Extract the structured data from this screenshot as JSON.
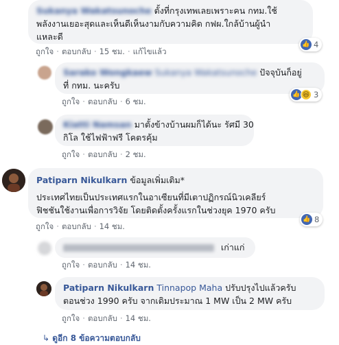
{
  "comments": [
    {
      "author": "Sukanya Wakatsunoche",
      "author_edited_note": "",
      "text": "ตั้งที่กรุงเทพเลยเพราะคน กทม.ใช้พลังงานเยอะสุดและเห็นดีเห็นงามกับความคิด กฟผ.ใกล้บ้านผู้นำแหละดี",
      "text_line1": "ตั้งที่กรุงเทพเลยเพราะคน กทม.ใช้",
      "text_line2": "พลังงานเยอะสุดและเห็นดีเห็นงามกับความคิด กฟผ.ใกล้บ้านผู้นำ",
      "text_line3": "แหละดี",
      "like": "ถูกใจ",
      "reply": "ตอบกลับ",
      "time": "15 ชม.",
      "edited": "แก้ไขแล้ว",
      "reactions": "4"
    },
    {
      "author": "Sarako Wongkaew",
      "tag": "Sukanya Wakatsunoche",
      "text_line1": "ปัจจุบันก็อยู่",
      "text_line2": "ที่ กทม. นะครับ",
      "like": "ถูกใจ",
      "reply": "ตอบกลับ",
      "time": "6 ชม.",
      "reactions": "3"
    },
    {
      "author": "Kiatti Namsan",
      "text_line1": "มาตั้งข้างบ้านผมก็ได้นะ รัศมี 30",
      "text_line2": "กิโล ใช้ไฟฟ้าฟรี โคตรคุ้ม",
      "like": "ถูกใจ",
      "reply": "ตอบกลับ",
      "time": "2 ชม."
    },
    {
      "author": "Patiparn Nikulkarn",
      "header_text": "ข้อมูลเพิ่มเติม*",
      "text_line1": "ประเทศไทยเป็นประเทศแรกในอาเซียนที่มีเตาปฏิกรณ์นิวเคลียร์",
      "text_line2": "ฟิชชันใช้งานเพื่อการวิจัย โดยติดตั้งครั้งแรกในช่วงยุค 1970 ครับ",
      "like": "ถูกใจ",
      "reply": "ตอบกลับ",
      "time": "14 ชม.",
      "reactions": "8"
    },
    {
      "author": "",
      "text_line1": "เก่าแก่",
      "like": "ถูกใจ",
      "reply": "ตอบกลับ",
      "time": "14 ชม."
    },
    {
      "author": "Patiparn Nikulkarn",
      "tag": "Tinnapop Maha",
      "text_line1": "ปรับปรุงไปแล้วครับ",
      "text_line2": "ตอนช่วง 1990 ครับ จากเดิมประมาณ 1 MW เป็น 2 MW ครับ",
      "like": "ถูกใจ",
      "reply": "ตอบกลับ",
      "time": "14 ชม."
    }
  ],
  "more_replies": "ดูอีก 8 ข้อความตอบกลับ",
  "colors": {
    "link": "#385898",
    "bubble": "#f2f3f5",
    "like": "#4267b2",
    "haha": "#f7c830"
  }
}
